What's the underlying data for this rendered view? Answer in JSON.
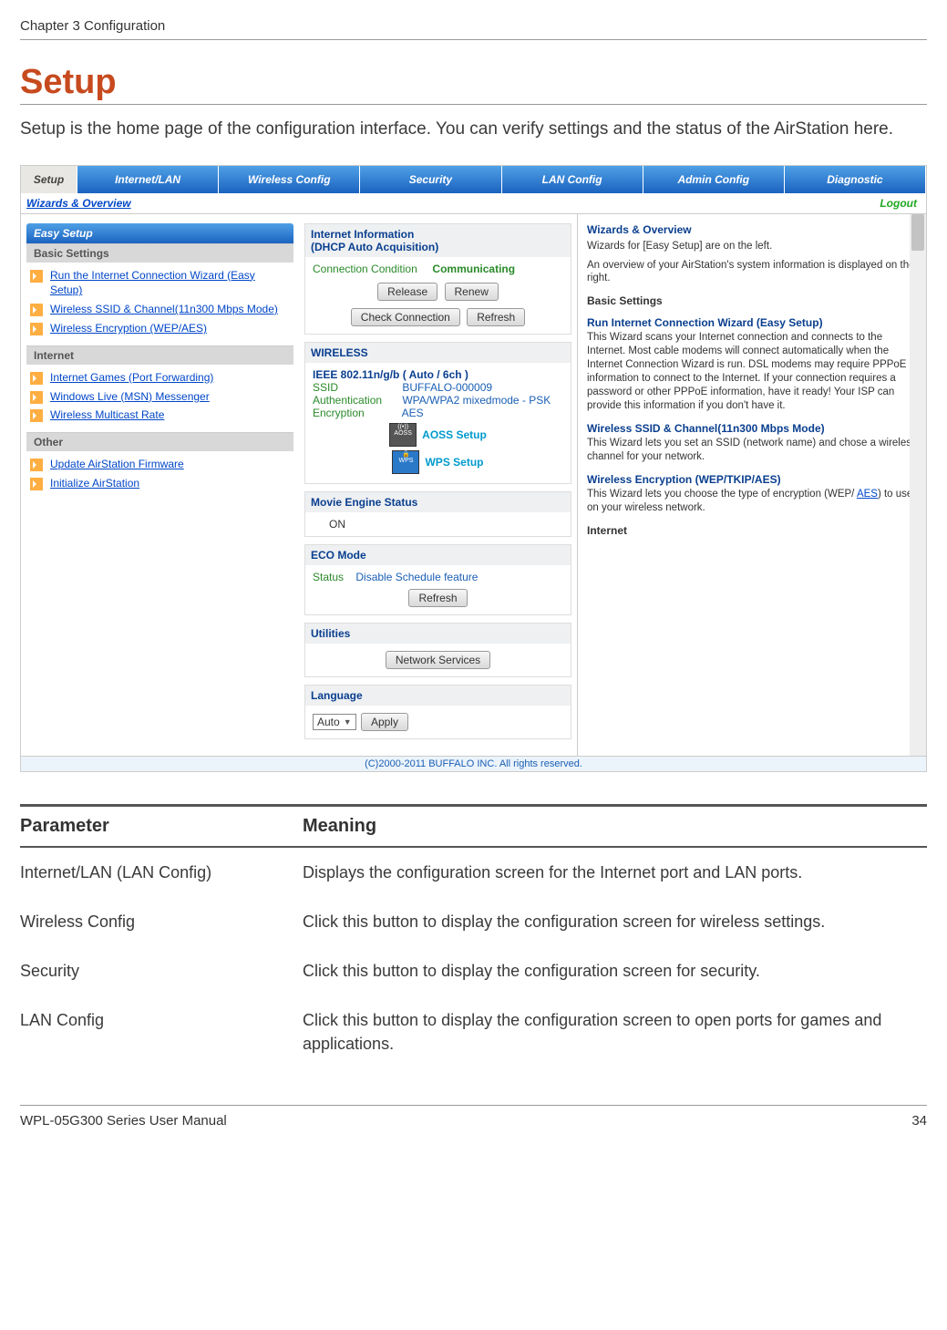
{
  "header": {
    "chapter": "Chapter 3  Configuration"
  },
  "title": "Setup",
  "intro": "Setup is the home page of the configuration interface. You can verify settings and the status of the AirStation here.",
  "nav": {
    "setup": "Setup",
    "tabs": [
      "Internet/LAN",
      "Wireless Config",
      "Security",
      "LAN Config",
      "Admin Config",
      "Diagnostic"
    ]
  },
  "subbar": {
    "wizards": "Wizards & Overview",
    "logout": "Logout"
  },
  "easy_setup": {
    "title": "Easy Setup",
    "basic": "Basic Settings",
    "basic_links": [
      "Run the Internet Connection Wizard (Easy Setup)",
      "Wireless SSID & Channel(11n300 Mbps Mode)",
      "Wireless Encryption (WEP/AES)"
    ],
    "internet": "Internet",
    "internet_links": [
      "Internet Games (Port Forwarding)",
      "Windows Live (MSN) Messenger",
      "Wireless Multicast Rate"
    ],
    "other": "Other",
    "other_links": [
      "Update AirStation Firmware",
      "Initialize AirStation"
    ]
  },
  "internet_info": {
    "title1": "Internet Information",
    "title2": "(DHCP Auto Acquisition)",
    "cond_lbl": "Connection Condition",
    "cond_val": "Communicating",
    "btn_release": "Release",
    "btn_renew": "Renew",
    "btn_check": "Check Connection",
    "btn_refresh": "Refresh"
  },
  "wireless": {
    "title": "WIRELESS",
    "band": "IEEE 802.11n/g/b ( Auto / 6ch )",
    "ssid_lbl": "SSID",
    "ssid_val": "BUFFALO-000009",
    "auth_lbl": "Authentication",
    "auth_val": "WPA/WPA2 mixedmode - PSK",
    "enc_lbl": "Encryption",
    "enc_val": "AES",
    "aoss": "AOSS Setup",
    "wps": "WPS Setup"
  },
  "movie": {
    "title": "Movie Engine Status",
    "val": "ON"
  },
  "eco": {
    "title": "ECO Mode",
    "status_lbl": "Status",
    "status_val": "Disable Schedule feature",
    "btn": "Refresh"
  },
  "util": {
    "title": "Utilities",
    "btn": "Network Services"
  },
  "lang": {
    "title": "Language",
    "val": "Auto",
    "btn": "Apply"
  },
  "help": {
    "title": "Wizards & Overview",
    "p1": "Wizards for [Easy Setup] are on the left.",
    "p2": "An overview of your AirStation's system information is displayed on the right.",
    "basic_hd": "Basic Settings",
    "wiz1_hd": "Run Internet Connection Wizard (Easy Setup)",
    "wiz1_tx": "This Wizard scans your Internet connection and connects to the Internet. Most cable modems will connect automatically when the Internet Connection Wizard is run. DSL modems may require PPPoE information to connect to the Internet. If your connection requires a password or other PPPoE information, have it ready! Your ISP can provide this information if you don't have it.",
    "wiz2_hd": "Wireless SSID & Channel(11n300 Mbps Mode)",
    "wiz2_tx": "This Wizard lets you set an SSID (network name) and chose a wireless channel for your network.",
    "wiz3_hd": "Wireless Encryption (WEP/TKIP/AES)",
    "wiz3_tx_a": "This Wizard lets you choose the type of encryption (WEP/ ",
    "wiz3_link": "AES",
    "wiz3_tx_b": ") to use on your wireless network.",
    "int_hd": "Internet"
  },
  "copyright": "(C)2000-2011 BUFFALO INC. All rights reserved.",
  "param_table": {
    "h1": "Parameter",
    "h2": "Meaning",
    "rows": [
      {
        "name": "Internet/LAN (LAN Config)",
        "meaning": "Displays the configuration screen for the Internet port and LAN ports."
      },
      {
        "name": "Wireless Config",
        "meaning": "Click this button to display the configuration screen for wireless settings."
      },
      {
        "name": "Security",
        "meaning": "Click this button to display the configuration screen for security."
      },
      {
        "name": "LAN Config",
        "meaning": "Click this button to display the configuration screen to open ports for games and applications."
      }
    ]
  },
  "footer": {
    "left": "WPL-05G300 Series User Manual",
    "right": "34"
  }
}
